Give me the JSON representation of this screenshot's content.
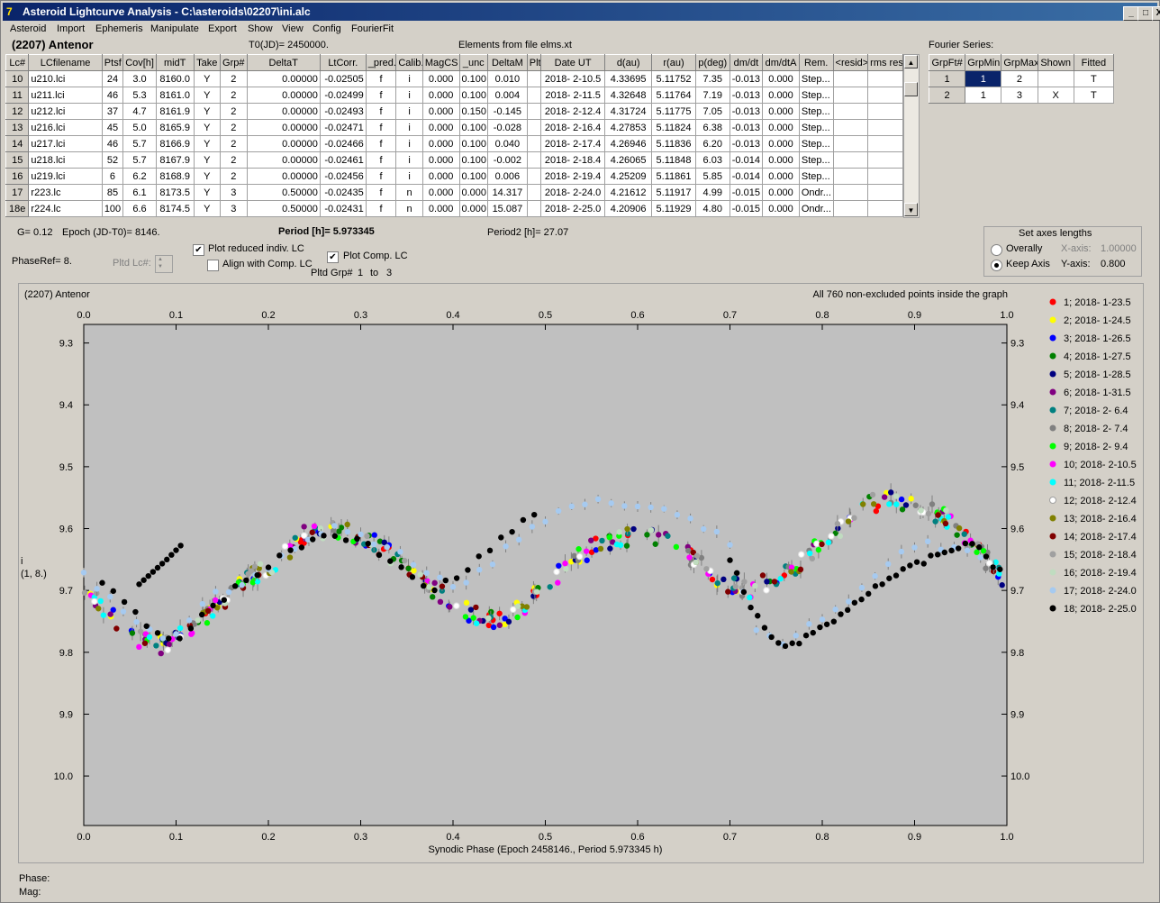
{
  "window": {
    "title": "Asteroid Lightcurve Analysis - C:\\asteroids\\02207\\ini.alc",
    "icon": "app-icon",
    "buttons": [
      "_",
      "□",
      "X"
    ]
  },
  "menu": [
    "Asteroid",
    "Import",
    "Ephemeris",
    "Manipulate",
    "Export",
    "Show",
    "View",
    "Config",
    "FourierFit"
  ],
  "header": {
    "asteroid": "(2207) Antenor",
    "t0": "T0(JD)= 2450000.",
    "elements": "Elements from file elms.xt"
  },
  "lc_table": {
    "columns": [
      "Lc#",
      "LCfilename",
      "Ptsf",
      "Cov[h]",
      "midT",
      "Take",
      "Grp#",
      "DeltaT",
      "LtCorr.",
      "_pred.",
      "Calib.",
      "MagCS",
      "_unc",
      "DeltaM",
      "Plt",
      "Date UT",
      "d(au)",
      "r(au)",
      "p(deg)",
      "dm/dt",
      "dm/dtA",
      "Rem.",
      "<resid>",
      "rms res"
    ],
    "rows": [
      [
        "10",
        "u210.lci",
        "24",
        "3.0",
        "8160.0",
        "Y",
        "2",
        "0.00000",
        "-0.02505",
        "f",
        "i",
        "0.000",
        "0.100",
        "0.010",
        "",
        "2018- 2-10.5",
        "4.33695",
        "5.11752",
        "7.35",
        "-0.013",
        "0.000",
        "Step...",
        "",
        ""
      ],
      [
        "11",
        "u211.lci",
        "46",
        "5.3",
        "8161.0",
        "Y",
        "2",
        "0.00000",
        "-0.02499",
        "f",
        "i",
        "0.000",
        "0.100",
        "0.004",
        "",
        "2018- 2-11.5",
        "4.32648",
        "5.11764",
        "7.19",
        "-0.013",
        "0.000",
        "Step...",
        "",
        ""
      ],
      [
        "12",
        "u212.lci",
        "37",
        "4.7",
        "8161.9",
        "Y",
        "2",
        "0.00000",
        "-0.02493",
        "f",
        "i",
        "0.000",
        "0.150",
        "-0.145",
        "",
        "2018- 2-12.4",
        "4.31724",
        "5.11775",
        "7.05",
        "-0.013",
        "0.000",
        "Step...",
        "",
        ""
      ],
      [
        "13",
        "u216.lci",
        "45",
        "5.0",
        "8165.9",
        "Y",
        "2",
        "0.00000",
        "-0.02471",
        "f",
        "i",
        "0.000",
        "0.100",
        "-0.028",
        "",
        "2018- 2-16.4",
        "4.27853",
        "5.11824",
        "6.38",
        "-0.013",
        "0.000",
        "Step...",
        "",
        ""
      ],
      [
        "14",
        "u217.lci",
        "46",
        "5.7",
        "8166.9",
        "Y",
        "2",
        "0.00000",
        "-0.02466",
        "f",
        "i",
        "0.000",
        "0.100",
        "0.040",
        "",
        "2018- 2-17.4",
        "4.26946",
        "5.11836",
        "6.20",
        "-0.013",
        "0.000",
        "Step...",
        "",
        ""
      ],
      [
        "15",
        "u218.lci",
        "52",
        "5.7",
        "8167.9",
        "Y",
        "2",
        "0.00000",
        "-0.02461",
        "f",
        "i",
        "0.000",
        "0.100",
        "-0.002",
        "",
        "2018- 2-18.4",
        "4.26065",
        "5.11848",
        "6.03",
        "-0.014",
        "0.000",
        "Step...",
        "",
        ""
      ],
      [
        "16",
        "u219.lci",
        "6",
        "6.2",
        "8168.9",
        "Y",
        "2",
        "0.00000",
        "-0.02456",
        "f",
        "i",
        "0.000",
        "0.100",
        "0.006",
        "",
        "2018- 2-19.4",
        "4.25209",
        "5.11861",
        "5.85",
        "-0.014",
        "0.000",
        "Step...",
        "",
        ""
      ],
      [
        "17",
        "r223.lc",
        "85",
        "6.1",
        "8173.5",
        "Y",
        "3",
        "0.50000",
        "-0.02435",
        "f",
        "n",
        "0.000",
        "0.000",
        "14.317",
        "",
        "2018- 2-24.0",
        "4.21612",
        "5.11917",
        "4.99",
        "-0.015",
        "0.000",
        "Ondr...",
        "",
        ""
      ],
      [
        "18e",
        "r224.lc",
        "100",
        "6.6",
        "8174.5",
        "Y",
        "3",
        "0.50000",
        "-0.02431",
        "f",
        "n",
        "0.000",
        "0.000",
        "15.087",
        "",
        "2018- 2-25.0",
        "4.20906",
        "5.11929",
        "4.80",
        "-0.015",
        "0.000",
        "Ondr...",
        "",
        ""
      ]
    ]
  },
  "fourier": {
    "label": "Fourier Series:",
    "columns": [
      "GrpFt#",
      "GrpMin",
      "GrpMax",
      "Shown",
      "Fitted"
    ],
    "rows": [
      [
        "1",
        "1",
        "2",
        "",
        "T"
      ],
      [
        "2",
        "1",
        "3",
        "X",
        "T"
      ]
    ]
  },
  "controls": {
    "g": "G= 0.12",
    "epoch": "Epoch (JD-T0)= 8146.",
    "period": "Period [h]= 5.973345",
    "period2": "Period2 [h]= 27.07",
    "phaseref": "PhaseRef= 8.",
    "pltd_lc": "Pltd Lc#:",
    "plot_reduced": "Plot reduced indiv. LC",
    "plot_reduced_checked": true,
    "align_comp": "Align with Comp. LC",
    "align_comp_checked": false,
    "plot_comp": "Plot Comp. LC",
    "plot_comp_checked": true,
    "pltd_grp": "Pltd Grp#",
    "pltd_grp_from": "1",
    "pltd_grp_to_label": "to",
    "pltd_grp_to": "3",
    "axes_title": "Set axes lengths",
    "overally": "Overally",
    "keep_axis": "Keep Axis",
    "xaxis_label": "X-axis:",
    "xaxis_value": "1.00000",
    "yaxis_label": "Y-axis:",
    "yaxis_value": "0.800"
  },
  "chart_data": {
    "type": "scatter",
    "title": "(2207) Antenor",
    "subtitle": "All 760 non-excluded points inside the graph",
    "xlabel": "Synodic Phase (Epoch 2458146., Period 5.973345 h)",
    "ylabel": [
      "i",
      "(1, 8.)"
    ],
    "xlim": [
      0.0,
      1.0
    ],
    "ylim": [
      10.08,
      9.27
    ],
    "y_inverted": true,
    "xticks": [
      "0.0",
      "0.1",
      "0.2",
      "0.3",
      "0.4",
      "0.5",
      "0.6",
      "0.7",
      "0.8",
      "0.9",
      "1.0"
    ],
    "yticks": [
      "9.3",
      "9.4",
      "9.5",
      "9.6",
      "9.7",
      "9.8",
      "9.9",
      "10.0"
    ],
    "series": [
      {
        "name": "1; 2018- 1-23.5",
        "color": "#ff0000"
      },
      {
        "name": "2; 2018- 1-24.5",
        "color": "#ffff00"
      },
      {
        "name": "3; 2018- 1-26.5",
        "color": "#0000ff"
      },
      {
        "name": "4; 2018- 1-27.5",
        "color": "#008000"
      },
      {
        "name": "5; 2018- 1-28.5",
        "color": "#000080"
      },
      {
        "name": "6; 2018- 1-31.5",
        "color": "#800080"
      },
      {
        "name": "7; 2018- 2- 6.4",
        "color": "#008080"
      },
      {
        "name": "8; 2018- 2- 7.4",
        "color": "#808080"
      },
      {
        "name": "9; 2018- 2- 9.4",
        "color": "#00ff00"
      },
      {
        "name": "10; 2018- 2-10.5",
        "color": "#ff00ff"
      },
      {
        "name": "11; 2018- 2-11.5",
        "color": "#00ffff"
      },
      {
        "name": "12; 2018- 2-12.4",
        "color": "#ffffff"
      },
      {
        "name": "13; 2018- 2-16.4",
        "color": "#808000"
      },
      {
        "name": "14; 2018- 2-17.4",
        "color": "#800000"
      },
      {
        "name": "15; 2018- 2-18.4",
        "color": "#a0a0a0"
      },
      {
        "name": "16; 2018- 2-19.4",
        "color": "#c0dcc0"
      },
      {
        "name": "17; 2018- 2-24.0",
        "color": "#a6caf0"
      },
      {
        "name": "18; 2018- 2-25.0",
        "color": "#000000"
      }
    ],
    "curves": {
      "group2_mean": [
        [
          0.0,
          9.7
        ],
        [
          0.03,
          9.74
        ],
        [
          0.06,
          9.78
        ],
        [
          0.09,
          9.79
        ],
        [
          0.12,
          9.76
        ],
        [
          0.15,
          9.72
        ],
        [
          0.18,
          9.68
        ],
        [
          0.21,
          9.65
        ],
        [
          0.24,
          9.61
        ],
        [
          0.27,
          9.6
        ],
        [
          0.3,
          9.61
        ],
        [
          0.33,
          9.64
        ],
        [
          0.36,
          9.68
        ],
        [
          0.39,
          9.71
        ],
        [
          0.42,
          9.74
        ],
        [
          0.45,
          9.75
        ],
        [
          0.48,
          9.72
        ],
        [
          0.51,
          9.68
        ],
        [
          0.54,
          9.64
        ],
        [
          0.57,
          9.62
        ],
        [
          0.6,
          9.61
        ],
        [
          0.63,
          9.62
        ],
        [
          0.66,
          9.65
        ],
        [
          0.69,
          9.69
        ],
        [
          0.72,
          9.7
        ],
        [
          0.75,
          9.68
        ],
        [
          0.78,
          9.65
        ],
        [
          0.81,
          9.61
        ],
        [
          0.84,
          9.57
        ],
        [
          0.87,
          9.55
        ],
        [
          0.9,
          9.56
        ],
        [
          0.93,
          9.58
        ],
        [
          0.96,
          9.62
        ],
        [
          1.0,
          9.69
        ]
      ],
      "group3_lc17": [
        [
          0.0,
          9.67
        ],
        [
          0.05,
          9.74
        ],
        [
          0.08,
          9.78
        ],
        [
          0.1,
          9.77
        ],
        [
          0.14,
          9.71
        ],
        [
          0.2,
          9.66
        ],
        [
          0.25,
          9.61
        ],
        [
          0.27,
          9.6
        ],
        [
          0.33,
          9.63
        ],
        [
          0.37,
          9.67
        ],
        [
          0.4,
          9.7
        ],
        [
          0.44,
          9.66
        ],
        [
          0.48,
          9.6
        ],
        [
          0.5,
          9.59
        ],
        [
          0.53,
          9.555
        ],
        [
          0.58,
          9.56
        ],
        [
          0.62,
          9.57
        ],
        [
          0.66,
          9.58
        ],
        [
          0.7,
          9.63
        ],
        [
          0.72,
          9.74
        ],
        [
          0.74,
          9.78
        ],
        [
          0.76,
          9.78
        ],
        [
          0.8,
          9.74
        ],
        [
          0.85,
          9.69
        ],
        [
          0.88,
          9.64
        ],
        [
          0.9,
          9.625
        ],
        [
          0.95,
          9.63
        ],
        [
          0.98,
          9.65
        ],
        [
          1.0,
          9.68
        ]
      ],
      "group3_lc18": [
        [
          0.0,
          9.67
        ],
        [
          0.02,
          9.69
        ],
        [
          0.05,
          9.73
        ],
        [
          0.08,
          9.77
        ],
        [
          0.1,
          9.78
        ],
        [
          0.13,
          9.74
        ],
        [
          0.17,
          9.69
        ],
        [
          0.22,
          9.64
        ],
        [
          0.26,
          9.61
        ],
        [
          0.3,
          9.62
        ],
        [
          0.34,
          9.66
        ],
        [
          0.38,
          9.7
        ],
        [
          0.41,
          9.67
        ],
        [
          0.45,
          9.62
        ],
        [
          0.49,
          9.575
        ],
        [
          0.5,
          9.56
        ]
      ]
    },
    "extra_segments": {
      "lc18_tail_a": [
        [
          0.0,
          9.67
        ],
        [
          0.06,
          9.69
        ],
        [
          0.09,
          9.65
        ],
        [
          0.11,
          9.62
        ]
      ],
      "lc18_tail_b": [
        [
          0.7,
          9.65
        ],
        [
          0.72,
          9.72
        ],
        [
          0.75,
          9.79
        ],
        [
          0.78,
          9.78
        ],
        [
          0.82,
          9.74
        ],
        [
          0.86,
          9.69
        ],
        [
          0.9,
          9.66
        ],
        [
          0.93,
          9.64
        ],
        [
          0.96,
          9.62
        ],
        [
          0.98,
          9.65
        ],
        [
          1.0,
          9.68
        ]
      ]
    }
  },
  "status": {
    "phase_label": "Phase:",
    "mag_label": "Mag:"
  }
}
